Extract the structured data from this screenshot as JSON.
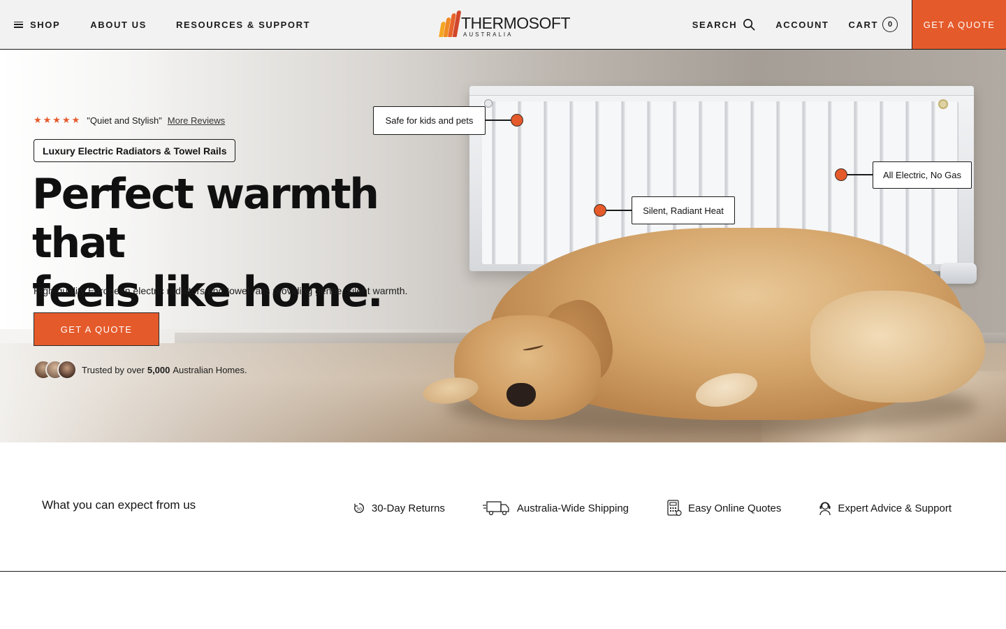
{
  "header": {
    "nav_left": {
      "shop": "SHOP",
      "about": "ABOUT US",
      "resources": "RESOURCES & SUPPORT"
    },
    "logo": {
      "name": "THERMOSOFT",
      "sub": "AUSTRALIA"
    },
    "nav_right": {
      "search": "SEARCH",
      "account": "ACCOUNT",
      "cart": "CART",
      "cart_count": "0"
    },
    "cta": "GET A QUOTE"
  },
  "hero": {
    "rating": {
      "stars": "★★★★★",
      "quote": "\"Quiet and Stylish\"",
      "link": "More Reviews"
    },
    "tag": "Luxury Electric Radiators & Towel Rails",
    "headline_line1": "Perfect warmth that",
    "headline_line2": "feels like home.",
    "subtitle": "High-quality European electric radiators and towel rails providing gentle, silent warmth.",
    "cta": "GET A QUOTE",
    "trust": {
      "prefix": "Trusted by over",
      "count": "5,000",
      "suffix": "Australian Homes."
    },
    "callouts": {
      "safe": "Safe for kids and pets",
      "silent": "Silent, Radiant Heat",
      "electric": "All Electric, No Gas"
    }
  },
  "expect": {
    "title": "What you can expect from us",
    "features": [
      {
        "label": "30-Day Returns",
        "icon": "returns-icon"
      },
      {
        "label": "Australia-Wide Shipping",
        "icon": "truck-icon"
      },
      {
        "label": "Easy Online Quotes",
        "icon": "calculator-icon"
      },
      {
        "label": "Expert Advice & Support",
        "icon": "support-icon"
      }
    ]
  },
  "colors": {
    "accent": "#e55a2b",
    "header_bg": "#f2f2f2",
    "text": "#111111"
  }
}
